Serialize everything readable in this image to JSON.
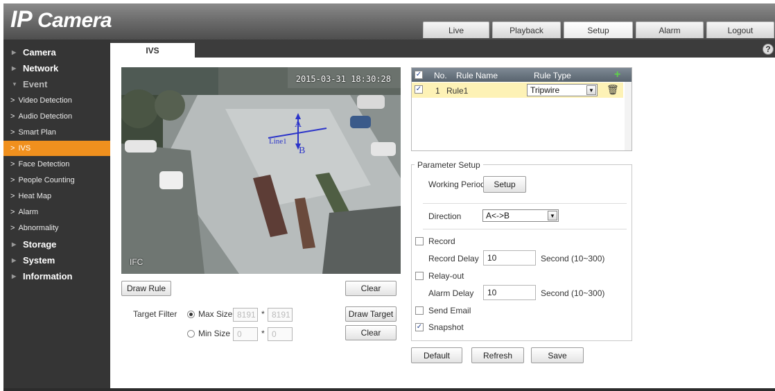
{
  "app": {
    "logo_ip": "IP",
    "logo_rest": " Camera"
  },
  "tabs": [
    "Live",
    "Playback",
    "Setup",
    "Alarm",
    "Logout"
  ],
  "sidebar": {
    "top": [
      "Camera",
      "Network",
      "Event",
      "Storage",
      "System",
      "Information"
    ],
    "event_items": [
      "Video Detection",
      "Audio Detection",
      "Smart Plan",
      "IVS",
      "Face Detection",
      "People Counting",
      "Heat Map",
      "Alarm",
      "Abnormality"
    ]
  },
  "page": {
    "tab": "IVS",
    "help": "?"
  },
  "video": {
    "timestamp": "2015-03-31 18:30:28",
    "channel": "IFC",
    "rule_name": "Line1",
    "side_a": "A",
    "side_b": "B"
  },
  "video_buttons": {
    "draw_rule": "Draw Rule",
    "clear": "Clear",
    "draw_target": "Draw Target",
    "clear2": "Clear"
  },
  "target_filter": {
    "label": "Target Filter",
    "max_label": "Max Size",
    "max_w": "8191",
    "max_h": "8191",
    "min_label": "Min Size",
    "min_w": "0",
    "min_h": "0",
    "sep": "*"
  },
  "rules": {
    "headers": [
      "No.",
      "Rule Name",
      "Rule Type"
    ],
    "add_icon": "+",
    "rows": [
      {
        "no": "1",
        "name": "Rule1",
        "type": "Tripwire"
      }
    ]
  },
  "params": {
    "title": "Parameter Setup",
    "working_period": "Working Period",
    "setup_btn": "Setup",
    "direction_label": "Direction",
    "direction_value": "A<->B",
    "record": "Record",
    "record_delay": "Record Delay",
    "record_delay_value": "10",
    "record_unit": "Second (10~300)",
    "relay_out": "Relay-out",
    "alarm_delay": "Alarm Delay",
    "alarm_delay_value": "10",
    "alarm_unit": "Second (10~300)",
    "send_email": "Send Email",
    "snapshot": "Snapshot"
  },
  "footer_buttons": {
    "default": "Default",
    "refresh": "Refresh",
    "save": "Save"
  },
  "colors": {
    "accent": "#f0901e",
    "sidebar": "#353535",
    "row_highlight": "#fdf2b6"
  }
}
